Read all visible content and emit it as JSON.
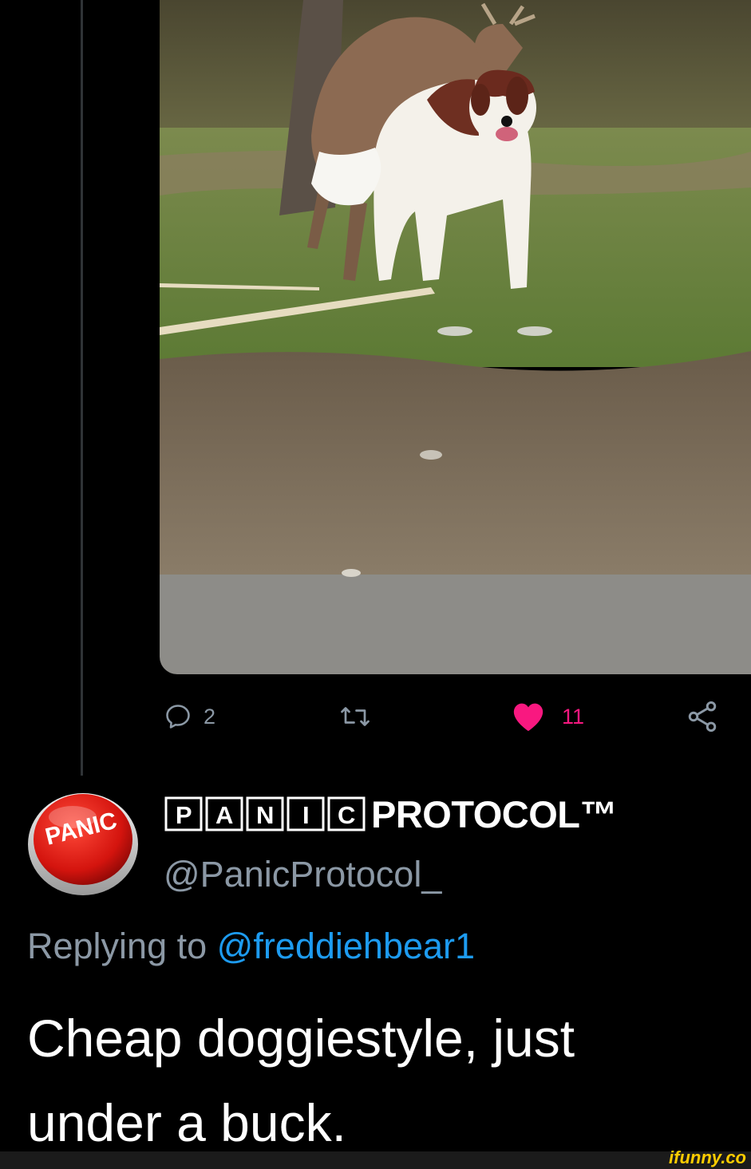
{
  "tweet_actions": {
    "reply_count": "2",
    "like_count": "11"
  },
  "author": {
    "display_name": "PROTOCOL™",
    "display_name_boxed_letters": [
      "P",
      "A",
      "N",
      "I",
      "C"
    ],
    "handle": "@PanicProtocol_",
    "avatar_text": "PANIC"
  },
  "reply_context": {
    "lead": "Replying to ",
    "mention": "@freddiehbear1"
  },
  "tweet": {
    "text_line1": "Cheap doggiestyle, just",
    "text_line2": "under a buck."
  },
  "watermark": "ifunny.co",
  "colors": {
    "background": "#000000",
    "secondary_text": "#8b98a5",
    "mention_blue": "#1d9bf0",
    "like_pink": "#f91880",
    "watermark_yellow": "#ffcc00"
  }
}
